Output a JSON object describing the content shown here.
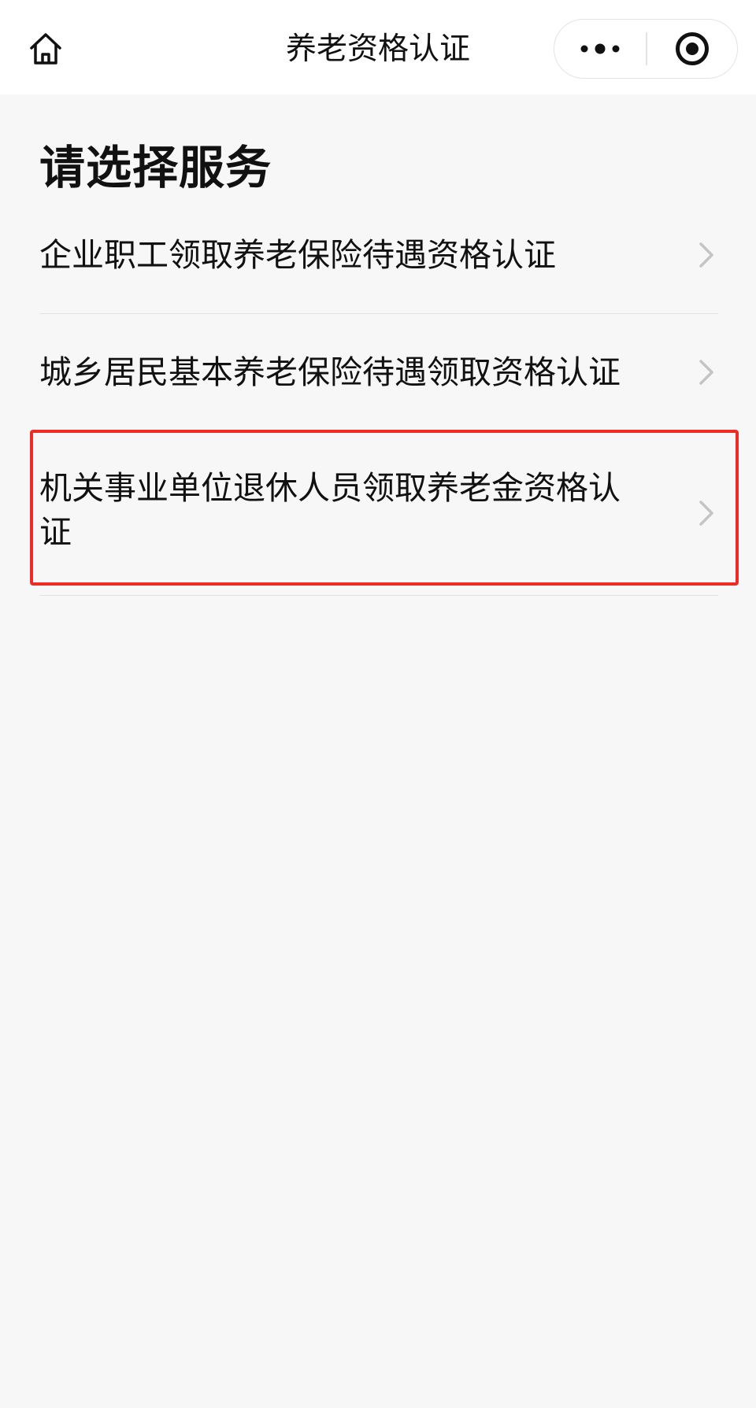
{
  "nav": {
    "title": "养老资格认证",
    "home_icon": "home-icon",
    "more_icon": "more-icon",
    "close_icon": "miniprogram-close-icon"
  },
  "page": {
    "title": "请选择服务"
  },
  "services": [
    {
      "label": "企业职工领取养老保险待遇资格认证",
      "icon": "chevron-right-icon"
    },
    {
      "label": "城乡居民基本养老保险待遇领取资格认证",
      "icon": "chevron-right-icon"
    },
    {
      "label": "机关事业单位退休人员领取养老金资格认证",
      "icon": "chevron-right-icon",
      "highlighted": true
    }
  ],
  "colors": {
    "background": "#f7f7f7",
    "topbar": "#ffffff",
    "text": "#111111",
    "divider": "#e2e2e2",
    "chevron": "#c4c4c4",
    "highlight": "#ee2b24"
  }
}
